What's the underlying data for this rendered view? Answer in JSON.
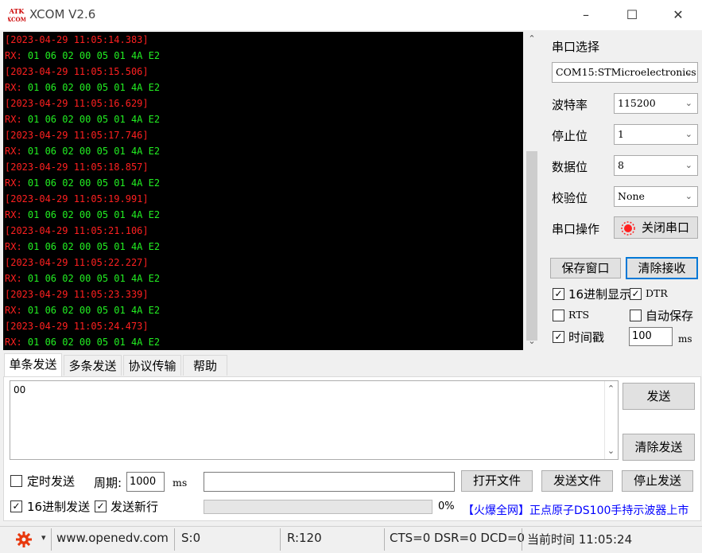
{
  "window": {
    "logo_text_top": "ATK",
    "logo_text_bottom": "XCOM",
    "title": "XCOM V2.6",
    "minimize_glyph": "–",
    "maximize_glyph": "☐",
    "close_glyph": "✕"
  },
  "receive": {
    "lines": [
      {
        "type": "ts",
        "text": "[2023-04-29 11:05:14.383]"
      },
      {
        "type": "rx",
        "prefix": "RX: ",
        "data": "01 06 02 00 05 01 4A E2"
      },
      {
        "type": "ts",
        "text": "[2023-04-29 11:05:15.506]"
      },
      {
        "type": "rx",
        "prefix": "RX: ",
        "data": "01 06 02 00 05 01 4A E2"
      },
      {
        "type": "ts",
        "text": "[2023-04-29 11:05:16.629]"
      },
      {
        "type": "rx",
        "prefix": "RX: ",
        "data": "01 06 02 00 05 01 4A E2"
      },
      {
        "type": "ts",
        "text": "[2023-04-29 11:05:17.746]"
      },
      {
        "type": "rx",
        "prefix": "RX: ",
        "data": "01 06 02 00 05 01 4A E2"
      },
      {
        "type": "ts",
        "text": "[2023-04-29 11:05:18.857]"
      },
      {
        "type": "rx",
        "prefix": "RX: ",
        "data": "01 06 02 00 05 01 4A E2"
      },
      {
        "type": "ts",
        "text": "[2023-04-29 11:05:19.991]"
      },
      {
        "type": "rx",
        "prefix": "RX: ",
        "data": "01 06 02 00 05 01 4A E2"
      },
      {
        "type": "ts",
        "text": "[2023-04-29 11:05:21.106]"
      },
      {
        "type": "rx",
        "prefix": "RX: ",
        "data": "01 06 02 00 05 01 4A E2"
      },
      {
        "type": "ts",
        "text": "[2023-04-29 11:05:22.227]"
      },
      {
        "type": "rx",
        "prefix": "RX: ",
        "data": "01 06 02 00 05 01 4A E2"
      },
      {
        "type": "ts",
        "text": "[2023-04-29 11:05:23.339]"
      },
      {
        "type": "rx",
        "prefix": "RX: ",
        "data": "01 06 02 00 05 01 4A E2"
      },
      {
        "type": "ts",
        "text": "[2023-04-29 11:05:24.473]"
      },
      {
        "type": "rx",
        "prefix": "RX: ",
        "data": "01 06 02 00 05 01 4A E2"
      }
    ],
    "scroll_up_glyph": "⌃",
    "scroll_down_glyph": "⌄"
  },
  "settings": {
    "port_select_label": "串口选择",
    "port_value": "COM15:STMicroelectronics",
    "baud_label": "波特率",
    "baud_value": "115200",
    "stop_label": "停止位",
    "stop_value": "1",
    "data_label": "数据位",
    "data_value": "8",
    "parity_label": "校验位",
    "parity_value": "None",
    "op_label": "串口操作",
    "close_port_button": "关闭串口",
    "save_window_button": "保存窗口",
    "clear_recv_button": "清除接收",
    "hex_display_label": "16进制显示",
    "dtr_label": "DTR",
    "rts_label": "RTS",
    "auto_save_label": "自动保存",
    "timestamp_label": "时间戳",
    "timestamp_ms_value": "100",
    "ms_unit": "ms",
    "check_glyph": "✓",
    "chevron_glyph": "⌄"
  },
  "tabs": [
    "单条发送",
    "多条发送",
    "协议传输",
    "帮助"
  ],
  "send": {
    "text": "00",
    "send_button": "发送",
    "clear_send_button": "清除发送",
    "timed_send_label": "定时发送",
    "period_label": "周期:",
    "period_value": "1000",
    "period_unit": "ms",
    "open_file_button": "打开文件",
    "send_file_button": "发送文件",
    "stop_send_button": "停止发送",
    "hex_send_label": "16进制发送",
    "send_newline_label": "发送新行",
    "progress_text": "0%",
    "progress": 0,
    "ad_text": "【火爆全网】正点原子DS100手持示波器上市"
  },
  "statusbar": {
    "website": "www.openedv.com",
    "sent": "S:0",
    "received": "R:120",
    "lines_status": "CTS=0 DSR=0 DCD=0",
    "current_time": "当前时间 11:05:24",
    "menu_arrow": "▾"
  },
  "colors": {
    "timestamp": "#ff2020",
    "rx_data": "#22ee22",
    "accent": "#0078d7",
    "ad_link": "#0000ff"
  }
}
